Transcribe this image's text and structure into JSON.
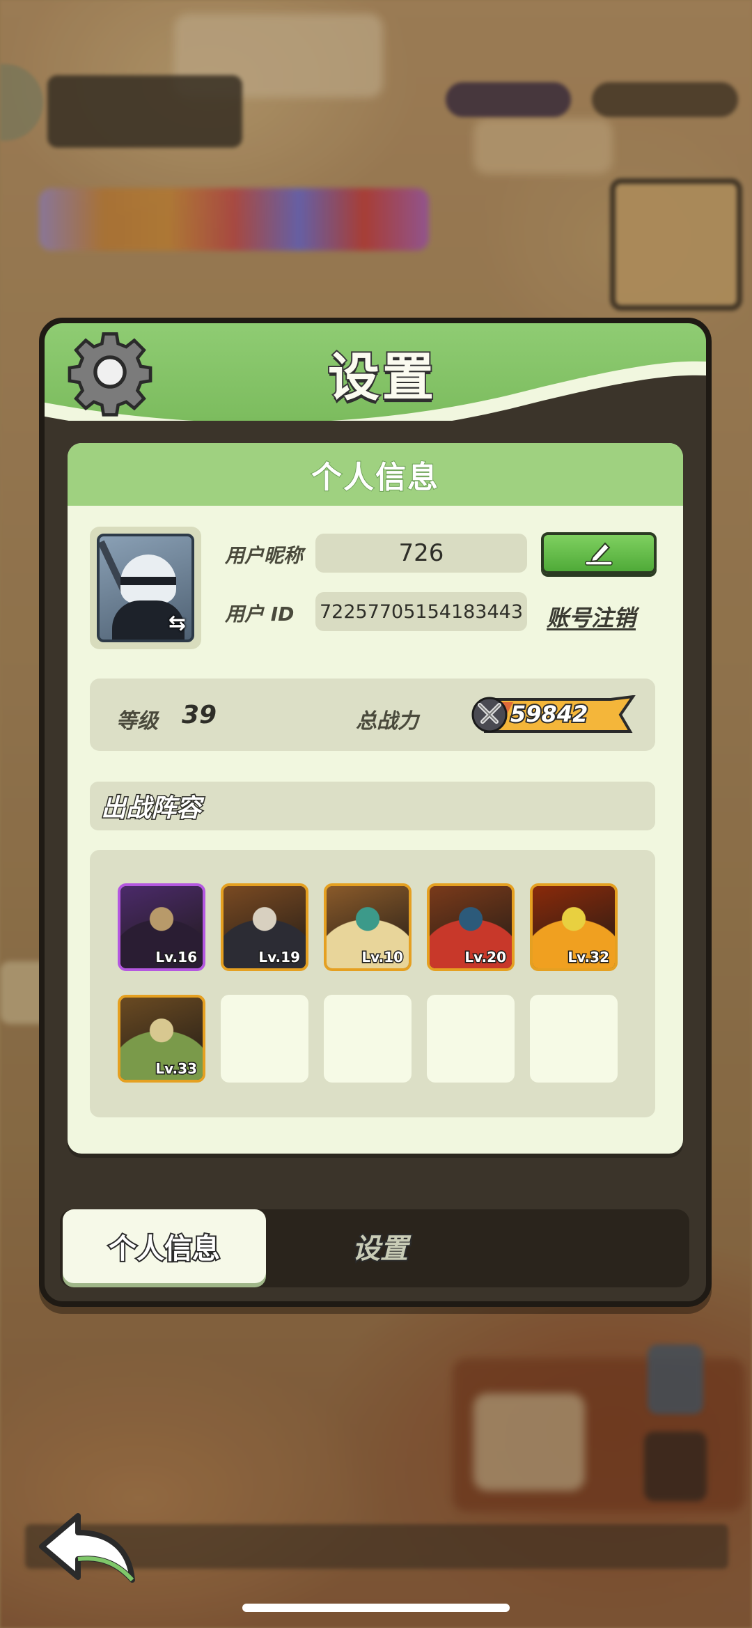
{
  "dialog": {
    "title": "设置",
    "card_header": "个人信息"
  },
  "profile": {
    "nickname_label": "用户昵称",
    "nickname": "726",
    "id_label": "用户 ID",
    "user_id": "72257705154183443",
    "cancel_account": "账号注销"
  },
  "stats": {
    "level_label": "等级",
    "level": "39",
    "power_label": "总战力",
    "power": "59842"
  },
  "lineup": {
    "title": "出战阵容",
    "heroes": [
      {
        "level": "Lv.16",
        "frame": "purple",
        "palette": [
          "#4b2a6a",
          "#2a1d33",
          "#b89a6a"
        ]
      },
      {
        "level": "Lv.19",
        "frame": "gold",
        "palette": [
          "#7a4a22",
          "#2c2c34",
          "#d8d0c0"
        ]
      },
      {
        "level": "Lv.10",
        "frame": "gold",
        "palette": [
          "#8a5a2a",
          "#e8d59a",
          "#3c9a8a"
        ]
      },
      {
        "level": "Lv.20",
        "frame": "gold",
        "palette": [
          "#7a3a1a",
          "#c8382a",
          "#2c5a7a"
        ]
      },
      {
        "level": "Lv.32",
        "frame": "gold",
        "palette": [
          "#8a2a0a",
          "#f0a020",
          "#e8d040"
        ]
      },
      {
        "level": "Lv.33",
        "frame": "gold",
        "palette": [
          "#6a4a22",
          "#7a9a4a",
          "#d8c890"
        ]
      }
    ],
    "empty_slots": 4
  },
  "tabs": {
    "active": "个人信息",
    "inactive": "设置"
  },
  "colors": {
    "header_green": "#8fcc73",
    "card_bg": "#f1f7df",
    "edit_button": "#5cb845",
    "power_badge": "#f4b63a"
  }
}
